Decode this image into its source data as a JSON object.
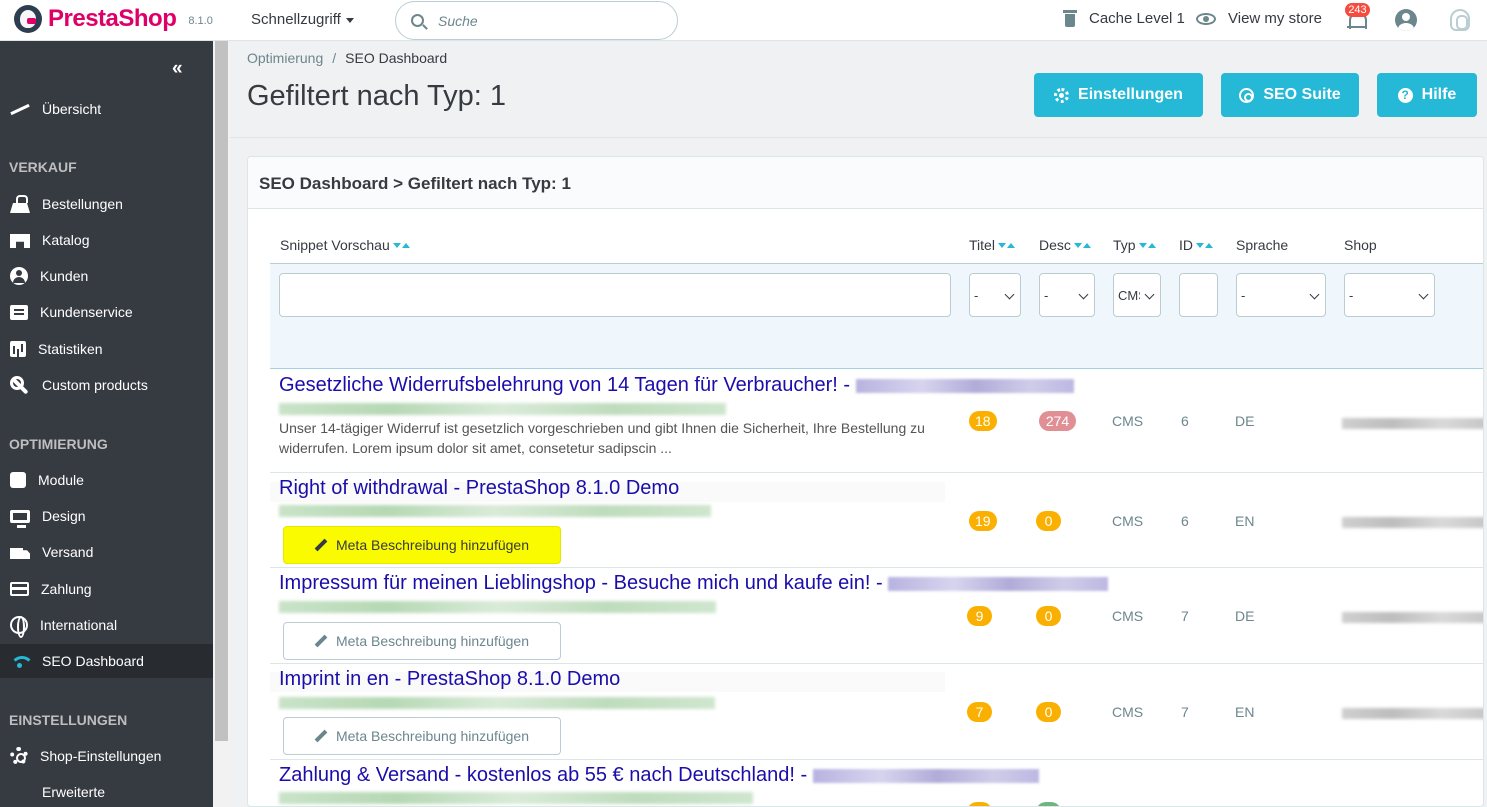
{
  "header": {
    "brand": "PrestaShop",
    "version": "8.1.0",
    "quick_access": "Schnellzugriff",
    "search_placeholder": "Suche",
    "cache": "Cache Level 1",
    "view_store": "View my store",
    "notifications_count": "243"
  },
  "sidebar": {
    "items": [
      {
        "label": "Übersicht"
      },
      {
        "label": "Bestellungen"
      },
      {
        "label": "Katalog"
      },
      {
        "label": "Kunden"
      },
      {
        "label": "Kundenservice"
      },
      {
        "label": "Statistiken"
      },
      {
        "label": "Custom products"
      },
      {
        "label": "Module"
      },
      {
        "label": "Design"
      },
      {
        "label": "Versand"
      },
      {
        "label": "Zahlung"
      },
      {
        "label": "International"
      },
      {
        "label": "SEO Dashboard"
      },
      {
        "label": "Shop-Einstellungen"
      },
      {
        "label": "Erweiterte"
      }
    ],
    "sections": {
      "sales": "VERKAUF",
      "optimization": "OPTIMIERUNG",
      "settings": "EINSTELLUNGEN"
    },
    "active": "SEO Dashboard"
  },
  "breadcrumb": {
    "parent": "Optimierung",
    "separator": "/",
    "current": "SEO Dashboard"
  },
  "page": {
    "title": "Gefiltert nach Typ: 1",
    "buttons": {
      "settings": "Einstellungen",
      "seo_suite": "SEO Suite",
      "help": "Hilfe"
    }
  },
  "card": {
    "title": "SEO Dashboard > Gefiltert nach Typ: 1",
    "columns": [
      "Snippet Vorschau",
      "Titel",
      "Desc",
      "Typ",
      "ID",
      "Sprache",
      "Shop"
    ],
    "filters": {
      "titel": "-",
      "desc": "-",
      "typ": "CMS",
      "sprache": "-",
      "shop": "-"
    },
    "add_meta_label": "Meta Beschreibung hinzufügen",
    "rows": [
      {
        "title": "Gesetzliche Widerrufsbelehrung von 14 Tagen für Verbraucher! - ",
        "desc": "Unser 14-tägiger Widerruf ist gesetzlich vorgeschrieben und gibt Ihnen die Sicherheit, Ihre Bestellung zu widerrufen. Lorem ipsum dolor sit amet, consetetur sadipscin ...",
        "titel": "18",
        "desc_len": "274",
        "typ": "CMS",
        "id": "6",
        "lang": "DE"
      },
      {
        "title": "Right of withdrawal - PrestaShop 8.1.0 Demo",
        "desc": "",
        "titel": "19",
        "desc_len": "0",
        "typ": "CMS",
        "id": "6",
        "lang": "EN"
      },
      {
        "title": "Impressum für meinen Lieblingshop - Besuche mich und kaufe ein! - ",
        "desc": "",
        "titel": "9",
        "desc_len": "0",
        "typ": "CMS",
        "id": "7",
        "lang": "DE"
      },
      {
        "title": "Imprint in en - PrestaShop 8.1.0 Demo",
        "desc": "",
        "titel": "7",
        "desc_len": "0",
        "typ": "CMS",
        "id": "7",
        "lang": "EN"
      },
      {
        "title": "Zahlung & Versand - kostenlos ab 55 € nach Deutschland! - ",
        "desc": "",
        "titel": "",
        "desc_len": "",
        "typ": "",
        "id": "",
        "lang": ""
      }
    ]
  },
  "colors": {
    "accent": "#25b9d7",
    "brand": "#df0067",
    "sidebar": "#363a41",
    "link": "#1a0dab",
    "badge_orange": "#fab000",
    "badge_red": "#e08f95",
    "highlight": "#fbfb00"
  }
}
